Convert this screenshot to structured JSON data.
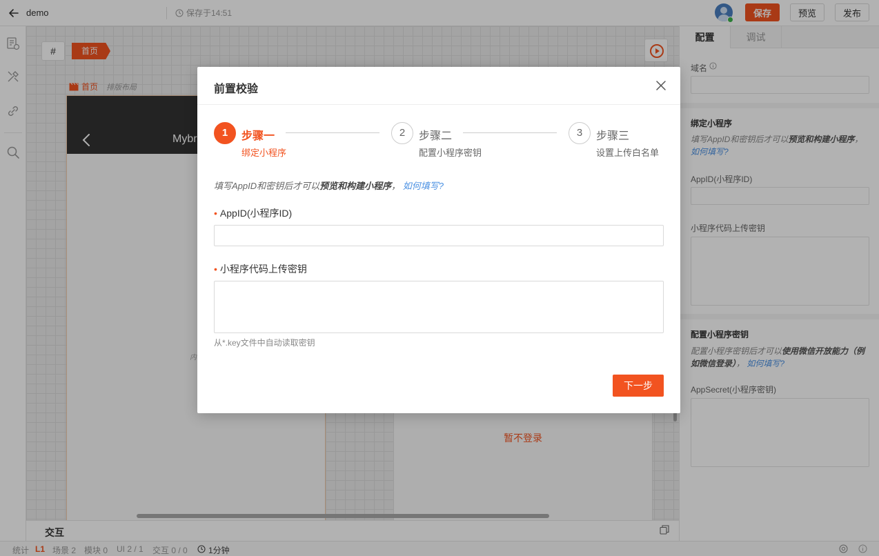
{
  "topbar": {
    "app_title": "demo",
    "save_status": "保存于14:51",
    "save_label": "保存",
    "preview_label": "预览",
    "publish_label": "发布"
  },
  "canvas": {
    "hash_label": "#",
    "breadcrumb": "首页",
    "page_label": "首页",
    "layout_label": "排版布局",
    "phone_title": "Mybr",
    "phone_inner_text": "内",
    "skip_login": "暂不登录"
  },
  "interact": {
    "title": "交互"
  },
  "statusbar": {
    "stats": "统计",
    "level": "L1",
    "scene": "场景 2",
    "module": "模块 0",
    "ui": "UI 2 / 1",
    "interaction": "交互 0 / 0",
    "time": "1分钟"
  },
  "rightpanel": {
    "tabs": [
      {
        "label": "配置",
        "active": true
      },
      {
        "label": "调试",
        "active": false
      }
    ],
    "domain_label": "域名",
    "bind_title": "绑定小程序",
    "bind_desc_pre": "填写AppID和密钥后才可以",
    "bind_desc_bold": "预览和构建小程序",
    "bind_desc_sep": "，",
    "bind_link": "如何填写?",
    "appid_label": "AppID(小程序ID)",
    "upload_key_label": "小程序代码上传密钥",
    "secret_title": "配置小程序密钥",
    "secret_desc_pre": "配置小程序密钥后才可以",
    "secret_desc_bold": "使用微信开放能力（例如微信登录）",
    "secret_desc_sep": "，",
    "secret_link": "如何填写?",
    "appsecret_label": "AppSecret(小程序密钥)"
  },
  "modal": {
    "title": "前置校验",
    "steps": [
      {
        "num": "1",
        "title": "步骤一",
        "sub": "绑定小程序",
        "active": true
      },
      {
        "num": "2",
        "title": "步骤二",
        "sub": "配置小程序密钥",
        "active": false
      },
      {
        "num": "3",
        "title": "步骤三",
        "sub": "设置上传白名单",
        "active": false
      }
    ],
    "hint_pre": "填写AppID和密钥后才可以",
    "hint_bold": "预览和构建小程序",
    "hint_sep": "，",
    "hint_link": "如何填写?",
    "appid_label": "AppID(小程序ID)",
    "appid_value": "",
    "key_label": "小程序代码上传密钥",
    "key_value": "",
    "key_help": "从*.key文件中自动读取密钥",
    "next_label": "下一步"
  },
  "colors": {
    "accent": "#f25320",
    "link": "#4a90e2"
  }
}
